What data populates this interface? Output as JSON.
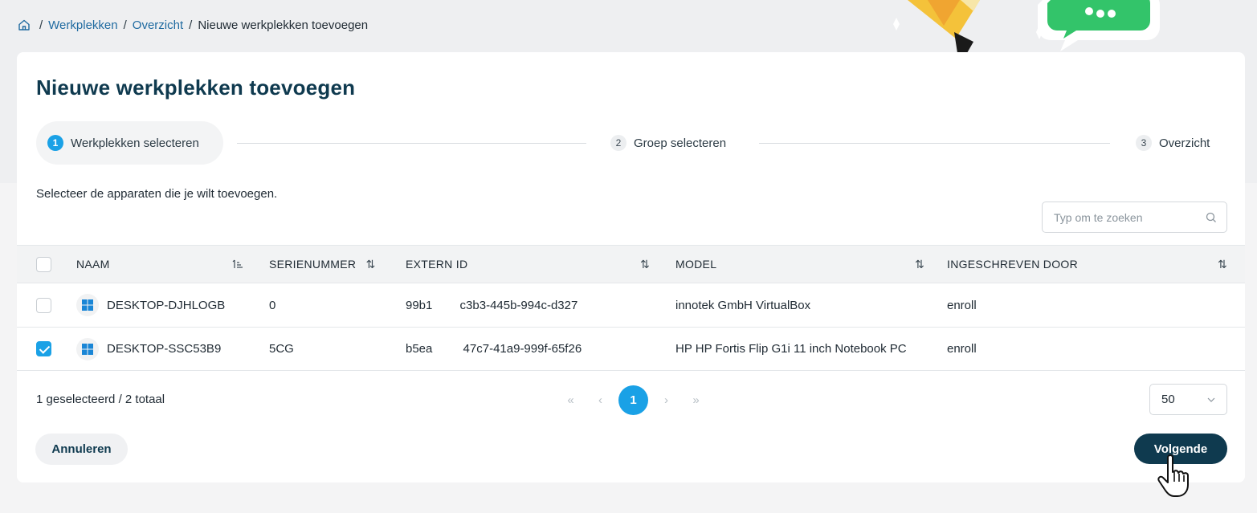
{
  "breadcrumb": {
    "home_icon": "home-icon",
    "items": [
      "Werkplekken",
      "Overzicht"
    ],
    "current": "Nieuwe werkplekken toevoegen"
  },
  "page": {
    "title": "Nieuwe werkplekken toevoegen",
    "instruction": "Selecteer de apparaten die je wilt toevoegen."
  },
  "stepper": {
    "steps": [
      {
        "number": "1",
        "label": "Werkplekken selecteren",
        "active": true
      },
      {
        "number": "2",
        "label": "Groep selecteren",
        "active": false
      },
      {
        "number": "3",
        "label": "Overzicht",
        "active": false
      }
    ]
  },
  "search": {
    "placeholder": "Typ om te zoeken",
    "icon": "search-icon"
  },
  "table": {
    "columns": [
      "NAAM",
      "SERIENUMMER",
      "EXTERN ID",
      "MODEL",
      "INGESCHREVEN DOOR"
    ],
    "rows": [
      {
        "checked": false,
        "name": "DESKTOP-DJHLOGB",
        "serial": "0",
        "extern_id_a": "99b1",
        "extern_id_b": "c3b3-445b-994c-d327",
        "model": "innotek GmbH VirtualBox",
        "enrolled_by": "enroll"
      },
      {
        "checked": true,
        "name": "DESKTOP-SSC53B9",
        "serial": "5CG",
        "extern_id_a": "b5ea",
        "extern_id_b": "47c7-41a9-999f-65f26",
        "model": "HP HP Fortis Flip G1i 11 inch Notebook PC",
        "enrolled_by": "enroll"
      }
    ]
  },
  "footer": {
    "selection_count": "1 geselecteerd / 2 totaal",
    "pagination": {
      "first": "«",
      "prev": "‹",
      "current": "1",
      "next": "›",
      "last": "»"
    },
    "page_size": "50"
  },
  "actions": {
    "cancel": "Annuleren",
    "next": "Volgende"
  },
  "colors": {
    "accent": "#1aa1e6",
    "primary_dark": "#0f3a4f",
    "link": "#1f6aa0"
  }
}
